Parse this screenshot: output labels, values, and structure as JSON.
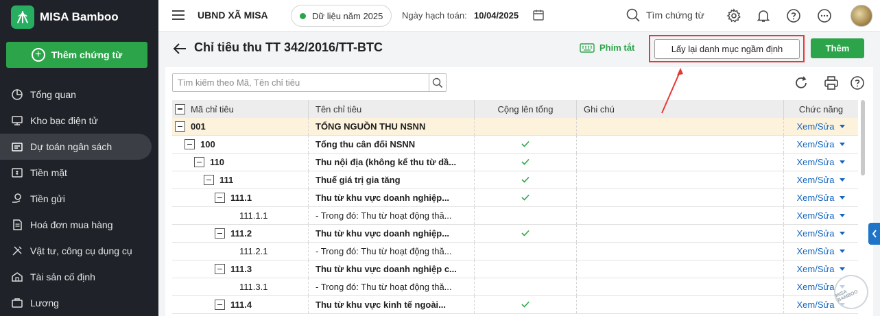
{
  "app": {
    "name": "MISA Bamboo",
    "add_voucher_label": "Thêm chứng từ"
  },
  "sidebar": {
    "items": [
      {
        "label": "Tổng quan",
        "icon": "chart-pie-icon"
      },
      {
        "label": "Kho bạc điện tử",
        "icon": "monitor-icon"
      },
      {
        "label": "Dự toán ngân sách",
        "icon": "budget-icon",
        "active": true
      },
      {
        "label": "Tiền mặt",
        "icon": "cash-icon"
      },
      {
        "label": "Tiền gửi",
        "icon": "deposit-icon"
      },
      {
        "label": "Hoá đơn mua hàng",
        "icon": "invoice-icon"
      },
      {
        "label": "Vật tư, công cụ dụng cụ",
        "icon": "tools-icon"
      },
      {
        "label": "Tài sản cố định",
        "icon": "asset-icon"
      },
      {
        "label": "Lương",
        "icon": "salary-icon"
      }
    ]
  },
  "topbar": {
    "org": "UBND XÃ MISA",
    "year_data": "Dữ liệu năm 2025",
    "accounting_date_label": "Ngày hạch toán:",
    "accounting_date": "10/04/2025",
    "search_label": "Tìm chứng từ"
  },
  "page": {
    "title": "Chỉ tiêu thu TT 342/2016/TT-BTC",
    "shortcut_label": "Phím tắt",
    "reset_label": "Lấy lại danh mục ngầm định",
    "add_label": "Thêm",
    "search_placeholder": "Tìm kiếm theo Mã, Tên chỉ tiêu"
  },
  "table": {
    "headers": {
      "code": "Mã chỉ tiêu",
      "name": "Tên chỉ tiêu",
      "sum": "Cộng lên tổng",
      "note": "Ghi chú",
      "action": "Chức năng"
    },
    "rows": [
      {
        "code": "001",
        "name": "TỔNG NGUỒN THU NSNN",
        "level": 0,
        "toggle": true,
        "bold": true,
        "check": false,
        "action": "Xem/Sửa",
        "selected": true
      },
      {
        "code": "100",
        "name": "Tổng thu cân đối NSNN",
        "level": 1,
        "toggle": true,
        "bold": true,
        "check": true,
        "action": "Xem/Sửa"
      },
      {
        "code": "110",
        "name": "Thu nội địa (không kể thu từ dầ...",
        "level": 2,
        "toggle": true,
        "bold": true,
        "check": true,
        "action": "Xem/Sửa"
      },
      {
        "code": "111",
        "name": "Thuế giá trị gia tăng",
        "level": 3,
        "toggle": true,
        "bold": true,
        "check": true,
        "action": "Xem/Sửa"
      },
      {
        "code": "111.1",
        "name": "Thu từ khu vực doanh nghiệp...",
        "level": 4,
        "toggle": true,
        "bold": true,
        "check": true,
        "action": "Xem/Sửa"
      },
      {
        "code": "111.1.1",
        "name": "- Trong đó: Thu từ hoạt động thă...",
        "level": 5,
        "toggle": false,
        "bold": false,
        "check": false,
        "action": "Xem/Sửa"
      },
      {
        "code": "111.2",
        "name": "Thu từ khu vực doanh nghiệp...",
        "level": 4,
        "toggle": true,
        "bold": true,
        "check": true,
        "action": "Xem/Sửa"
      },
      {
        "code": "111.2.1",
        "name": "- Trong đó: Thu từ hoạt động thă...",
        "level": 5,
        "toggle": false,
        "bold": false,
        "check": false,
        "action": "Xem/Sửa"
      },
      {
        "code": "111.3",
        "name": "Thu từ khu vực doanh nghiệp c...",
        "level": 4,
        "toggle": true,
        "bold": true,
        "check": false,
        "action": "Xem/Sửa"
      },
      {
        "code": "111.3.1",
        "name": "- Trong đó: Thu từ hoạt động thă...",
        "level": 5,
        "toggle": false,
        "bold": false,
        "check": false,
        "action": "Xem/Sửa"
      },
      {
        "code": "111.4",
        "name": "Thu từ khu vực kinh tế ngoài...",
        "level": 4,
        "toggle": true,
        "bold": true,
        "check": true,
        "action": "Xem/Sửa"
      }
    ]
  },
  "watermark": "MISA BAMBOO",
  "colors": {
    "brand_green": "#2ca44a",
    "sidebar_bg": "#1f2329",
    "link_blue": "#1565c0",
    "highlight_red": "#e53935",
    "selected_row": "#fdf3dc"
  }
}
